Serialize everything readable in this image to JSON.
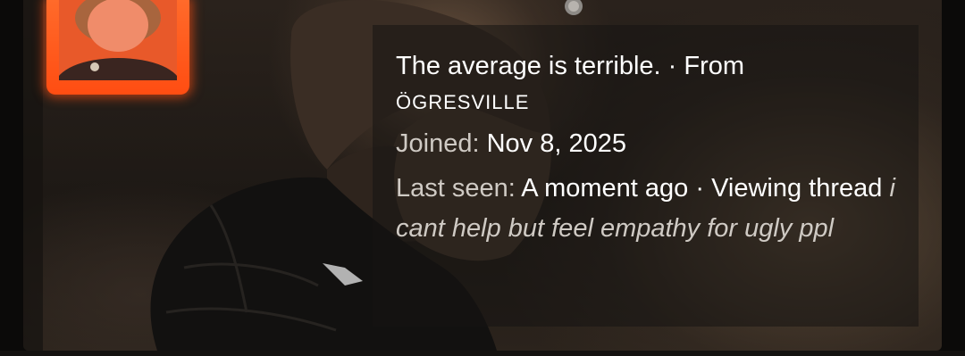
{
  "profile": {
    "status": "The average is terrible.",
    "from_label": "From",
    "location": "ÖGRESVILLE",
    "joined_label": "Joined:",
    "joined_value": "Nov 8, 2025",
    "last_seen_label": "Last seen:",
    "last_seen_value": "A moment ago",
    "activity_label": "Viewing thread",
    "activity_thread": "i cant help but feel empathy for ugly ppl"
  },
  "colors": {
    "avatar_frame": "#ff5a1c",
    "text_primary": "#ffffff",
    "text_muted": "#cfcac4"
  }
}
